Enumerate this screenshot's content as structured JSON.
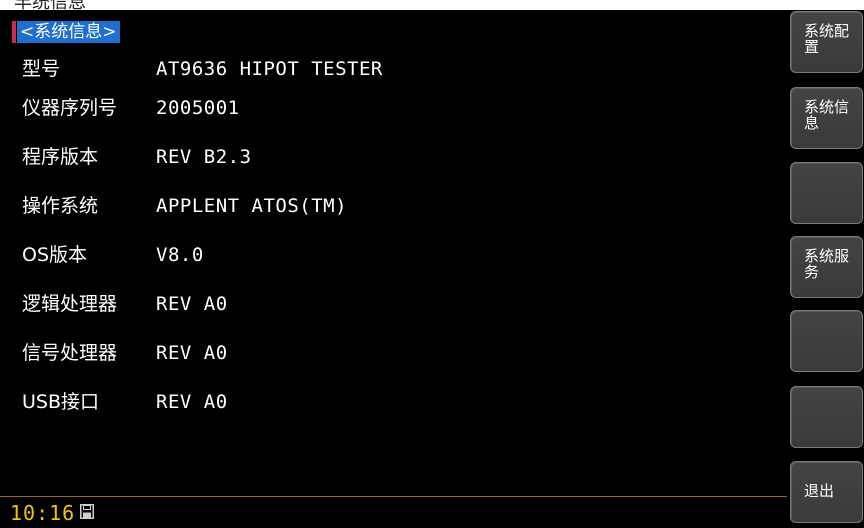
{
  "window": {
    "top_partial_text": "丰统信息"
  },
  "page": {
    "title": "<系统信息>"
  },
  "info_rows": [
    {
      "label": "型号",
      "value": "AT9636 HIPOT TESTER"
    },
    {
      "label": "仪器序列号",
      "value": "2005001"
    },
    {
      "label": "程序版本",
      "value": "REV B2.3"
    },
    {
      "label": "操作系统",
      "value": "APPLENT ATOS(TM)"
    },
    {
      "label": "OS版本",
      "value": "V8.0"
    },
    {
      "label": "逻辑处理器",
      "value": "REV A0"
    },
    {
      "label": "信号处理器",
      "value": "REV A0"
    },
    {
      "label": "USB接口",
      "value": "REV A0"
    }
  ],
  "softkeys": [
    {
      "label": "系统配置"
    },
    {
      "label": "系统信息"
    },
    {
      "label": ""
    },
    {
      "label": "系统服务"
    },
    {
      "label": ""
    },
    {
      "label": ""
    },
    {
      "label": "退出"
    }
  ],
  "status": {
    "time": "10:16",
    "storage_icon": "floppy-disk-icon"
  },
  "colors": {
    "title_bg": "#1f6fd0",
    "title_accent": "#d22a52",
    "clock": "#f5c400",
    "divider": "#9a6a1a",
    "softkey_bg": "#444444"
  }
}
